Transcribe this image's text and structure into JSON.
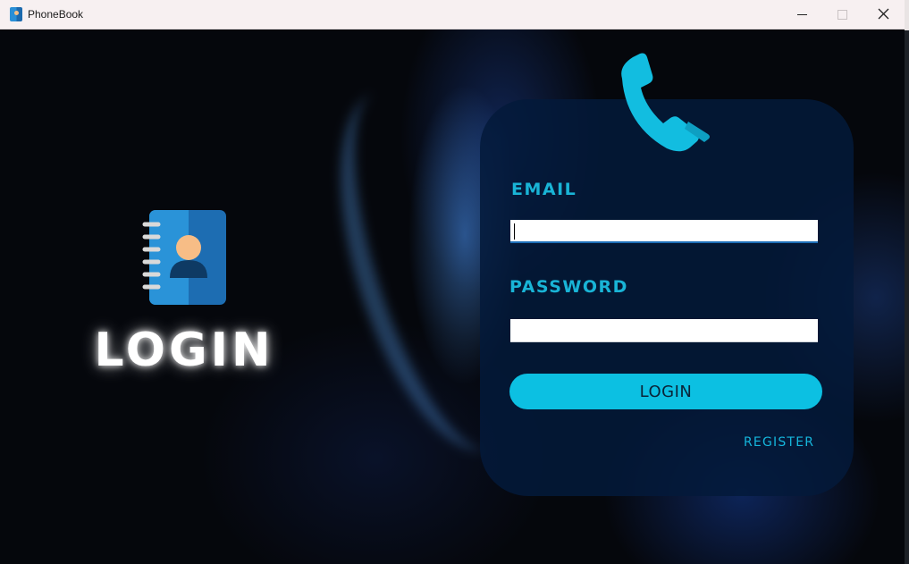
{
  "window": {
    "title": "PhoneBook",
    "app_icon": "phonebook-app-icon"
  },
  "colors": {
    "accent": "#0cc0e2",
    "label": "#19b4d6",
    "card": "#031a3a",
    "background": "#05070c"
  },
  "branding": {
    "icon": "contact-book-icon",
    "heading": "LOGIN"
  },
  "form": {
    "decor_icon": "phone-handset-icon",
    "email_label": "EMAIL",
    "email_value": "",
    "password_label": "PASSWORD",
    "password_value": "",
    "login_button": "LOGIN",
    "register_link": "REGISTER"
  }
}
